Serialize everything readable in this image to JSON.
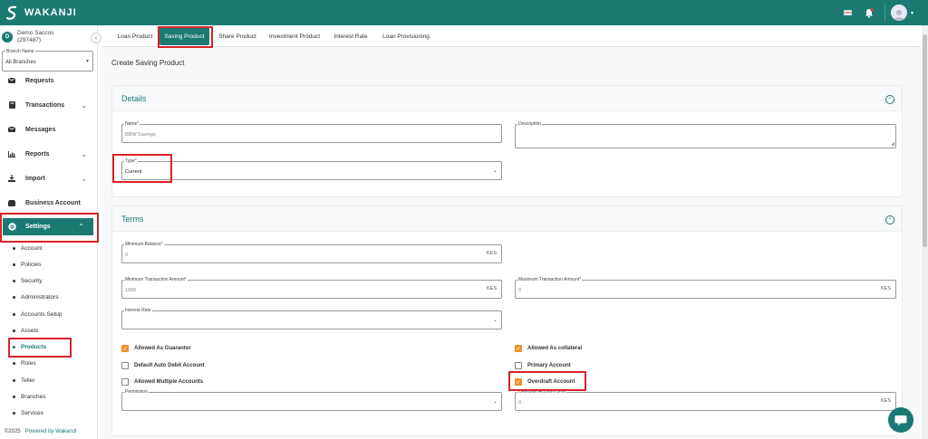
{
  "brand": {
    "name": "WAKANJI",
    "color": "#1a7a72"
  },
  "user": {
    "initial": "D",
    "name": "Demo Saccos",
    "id": "(297487)"
  },
  "branch": {
    "label": "Branch Name",
    "value": "All Branches"
  },
  "nav": {
    "requests": "Requests",
    "transactions": "Transactions",
    "messages": "Messages",
    "reports": "Reports",
    "import": "Import",
    "business_account": "Business Account",
    "settings": "Settings"
  },
  "settings_sub": [
    "Account",
    "Policies",
    "Security",
    "Administrators",
    "Accounts Setup",
    "Assets",
    "Products",
    "Roles",
    "Teller",
    "Branches",
    "Services"
  ],
  "footer": {
    "copyright": "©2025",
    "powered": "Powered by Wakandi"
  },
  "tabs": [
    "Loan Product",
    "Saving Product",
    "Share Product",
    "Investment Product",
    "Interest Rate",
    "Loan Provisioning"
  ],
  "page_title": "Create Saving Product",
  "details": {
    "title": "Details",
    "name_label": "Name",
    "name_value": "BBW Savings",
    "description_label": "Description",
    "type_label": "Type",
    "type_value": "Current"
  },
  "terms": {
    "title": "Terms",
    "min_balance_label": "Minimum Balance",
    "min_balance_value": "0",
    "min_tx_label": "Minimum Transaction Amount",
    "min_tx_value": "1000",
    "max_tx_label": "Maximum Transaction Amount",
    "max_tx_value": "0",
    "currency": "KES",
    "interest_rate_label": "Interest Rate",
    "permission_label": "Permission",
    "overdraft_limit_label": "Overdraft Account Limit",
    "overdraft_limit_value": "0",
    "checks": {
      "allowed_guarantor": "Allowed As Guarantor",
      "allowed_collateral": "Allowed As collateral",
      "default_auto_debit": "Default Auto Debit Account",
      "primary_account": "Primary Account",
      "allowed_multiple": "Allowed Multiple Accounts",
      "overdraft_account": "Overdraft Account"
    }
  }
}
